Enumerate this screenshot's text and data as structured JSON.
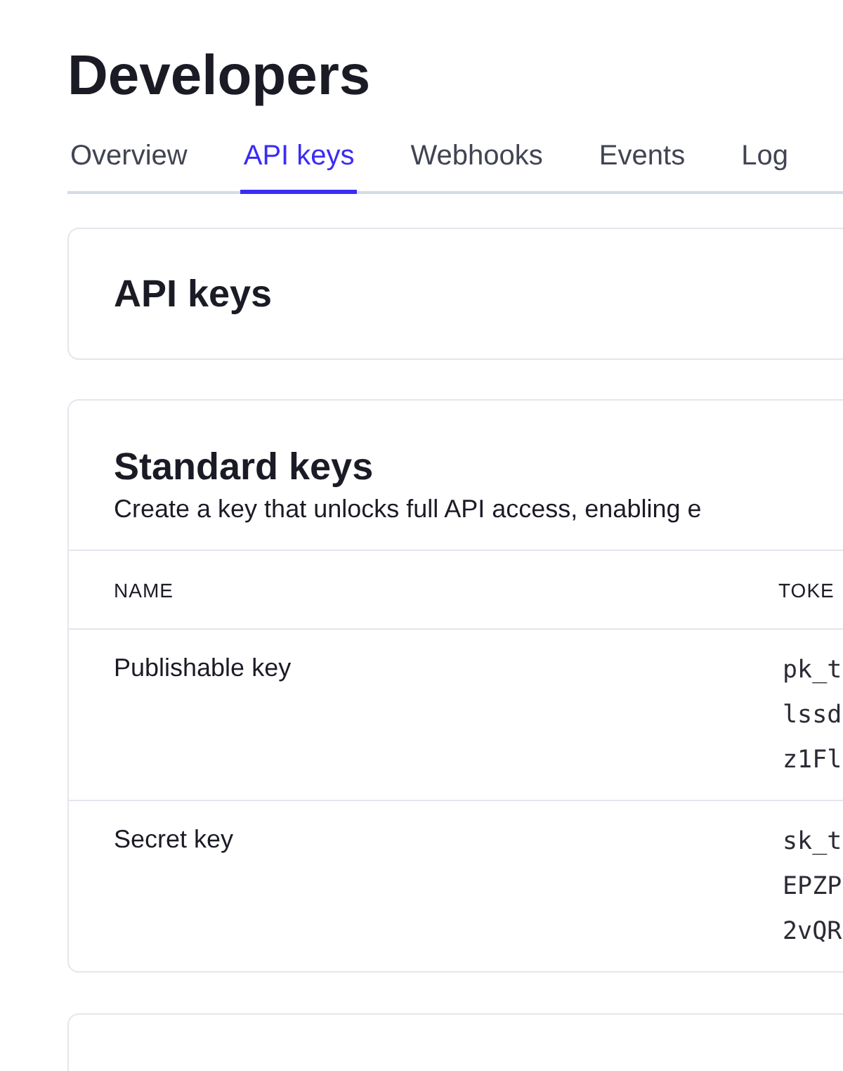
{
  "title": "Developers",
  "tabs": [
    {
      "label": "Overview",
      "selected": false
    },
    {
      "label": "API keys",
      "selected": true
    },
    {
      "label": "Webhooks",
      "selected": false
    },
    {
      "label": "Events",
      "selected": false
    },
    {
      "label": "Log",
      "selected": false
    }
  ],
  "api_keys_card": {
    "heading": "API keys"
  },
  "standard_keys": {
    "heading": "Standard keys",
    "description": "Create a key that unlocks full API access, enabling e",
    "columns": [
      "NAME",
      "TOKE"
    ],
    "rows": [
      {
        "name": "Publishable key",
        "token_lines": [
          "pk_t",
          "lssd",
          "z1Fl"
        ]
      },
      {
        "name": "Secret key",
        "token_lines": [
          "sk_t",
          "EPZP",
          "2vQR"
        ]
      }
    ]
  }
}
